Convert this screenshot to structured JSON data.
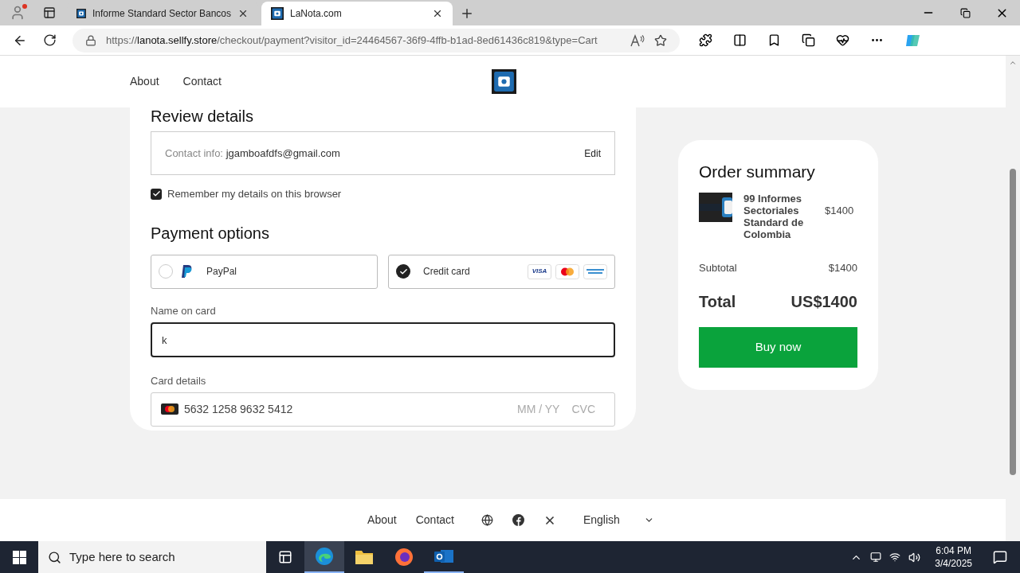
{
  "browser": {
    "tabs": [
      {
        "title": "Informe Standard Sector Bancos",
        "selected": false
      },
      {
        "title": "LaNota.com",
        "selected": true
      }
    ],
    "url": {
      "host_prefix": "https://",
      "host": "lanota.sellfy.store",
      "path": "/checkout/payment?visitor_id=24464567-36f9-4ffb-b1ad-8ed61436c819&type=Cart"
    }
  },
  "header": {
    "nav": [
      "About",
      "Contact"
    ]
  },
  "checkout": {
    "review_title": "Review details",
    "contact_label": "Contact info:",
    "contact_value": "jgamboafdfs@gmail.com",
    "edit": "Edit",
    "remember": {
      "label": "Remember my details on this browser",
      "checked": true
    },
    "payment_title": "Payment options",
    "options": [
      {
        "kind": "paypal",
        "label": "PayPal",
        "selected": false
      },
      {
        "kind": "card",
        "label": "Credit card",
        "selected": true,
        "brand": "VISA"
      }
    ],
    "name_label": "Name on card",
    "name_value": "k",
    "card_label": "Card details",
    "card_number": "5632 1258 9632 5412",
    "expiry_placeholder": "MM / YY",
    "cvc_placeholder": "CVC"
  },
  "summary": {
    "title": "Order summary",
    "item": {
      "name": "99 Informes Sectoriales Standard de Colombia",
      "price": "$1400"
    },
    "subtotal_label": "Subtotal",
    "subtotal": "$1400",
    "total_label": "Total",
    "total": "US$1400",
    "buy": "Buy now"
  },
  "footer": {
    "links": [
      "About",
      "Contact"
    ],
    "language": "English"
  },
  "taskbar": {
    "search_placeholder": "Type here to search",
    "time": "6:04 PM",
    "date": "3/4/2025"
  }
}
